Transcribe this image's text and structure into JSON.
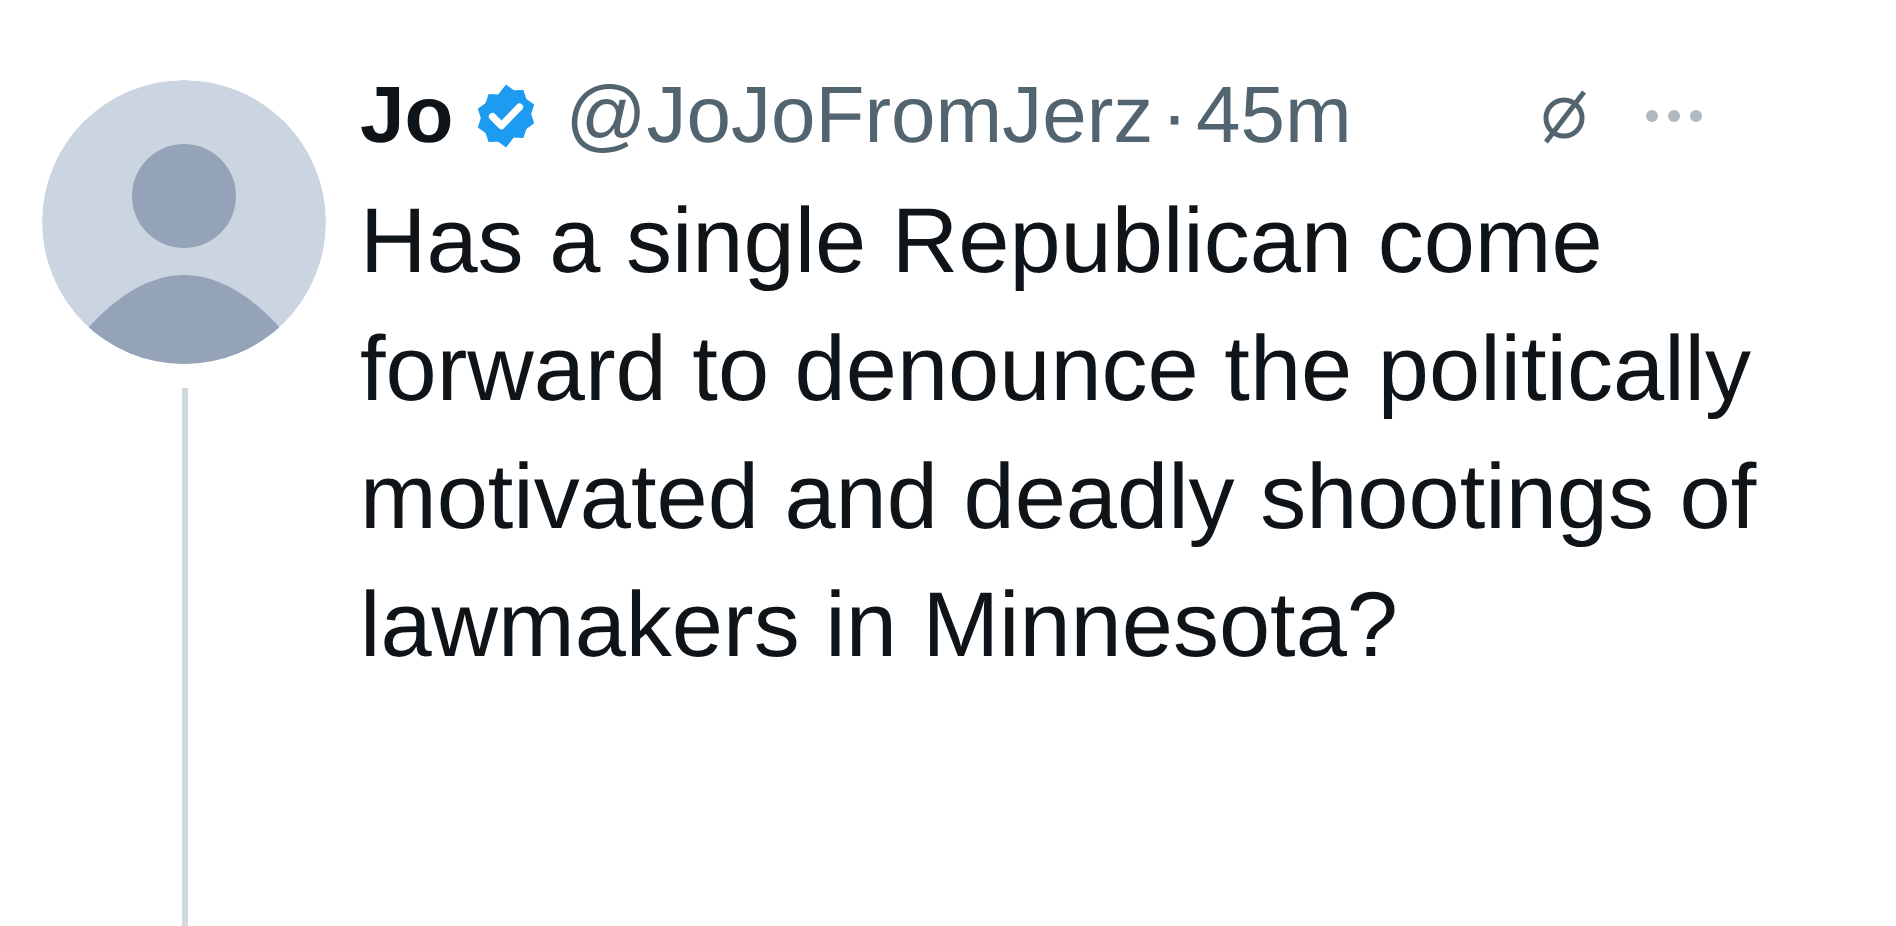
{
  "tweet": {
    "author": {
      "name": "Jo",
      "verified": true,
      "handle": "@JoJoFromJerz",
      "separator": "·",
      "time": "45m"
    },
    "text": "Has a single Republican come forward to denounce the politically motivated and deadly shootings of lawmakers in Minnesota?"
  }
}
